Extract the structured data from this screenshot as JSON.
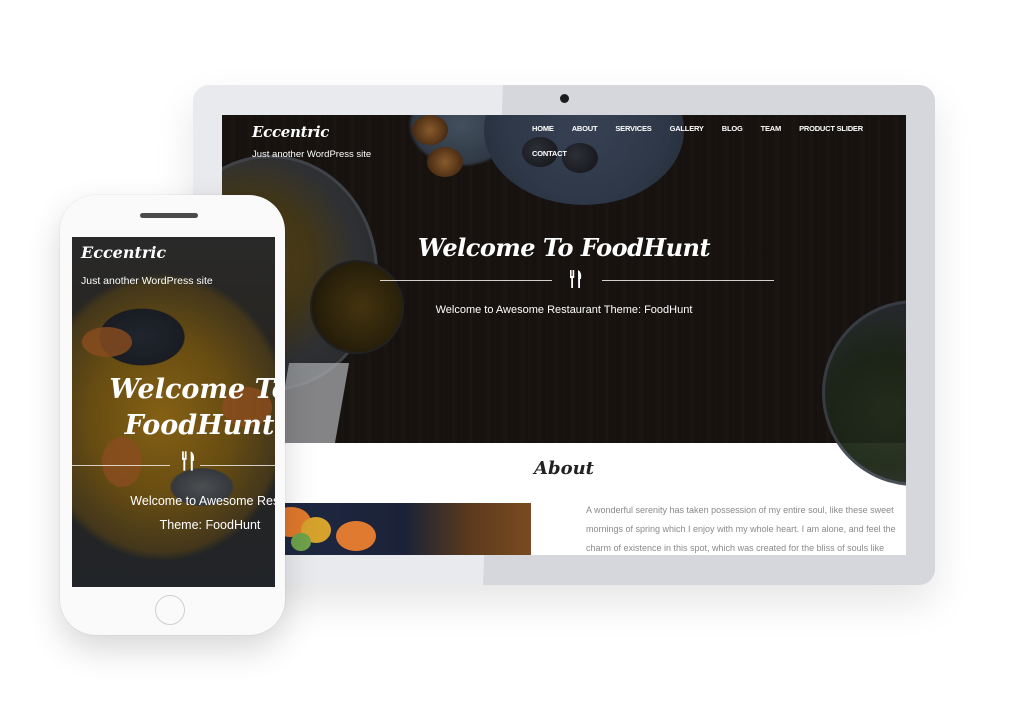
{
  "desktop": {
    "site": {
      "logo": "Eccentric",
      "tagline": "Just another WordPress site"
    },
    "nav": {
      "items": [
        {
          "label": "HOME"
        },
        {
          "label": "ABOUT"
        },
        {
          "label": "SERVICES"
        },
        {
          "label": "GALLERY"
        },
        {
          "label": "BLOG"
        },
        {
          "label": "TEAM"
        },
        {
          "label": "PRODUCT SLIDER"
        },
        {
          "label": "CONTACT"
        }
      ]
    },
    "hero": {
      "title": "Welcome To FoodHunt",
      "icon": "utensils-icon",
      "icon_glyph": "🍴",
      "subtitle": "Welcome to Awesome Restaurant Theme: FoodHunt"
    },
    "about": {
      "title": "About",
      "text": "A wonderful serenity has taken possession of my entire soul, like these sweet mornings of spring which I enjoy with my whole heart. I am alone, and feel the charm of existence in this spot, which was created for the bliss of souls like"
    }
  },
  "mobile": {
    "site": {
      "logo": "Eccentric",
      "tagline": "Just another WordPress site"
    },
    "hero": {
      "title_line1": "Welcome To",
      "title_line2": "FoodHunt",
      "icon": "utensils-icon",
      "icon_glyph": "🍴",
      "subtitle_line1": "Welcome to Awesome Restaura",
      "subtitle_line2": "Theme: FoodHunt"
    }
  },
  "colors": {
    "device_frame": "#e9eaee",
    "phone_frame": "#fafafa",
    "hero_text": "#ffffff",
    "about_text": "#8a8a8a"
  }
}
